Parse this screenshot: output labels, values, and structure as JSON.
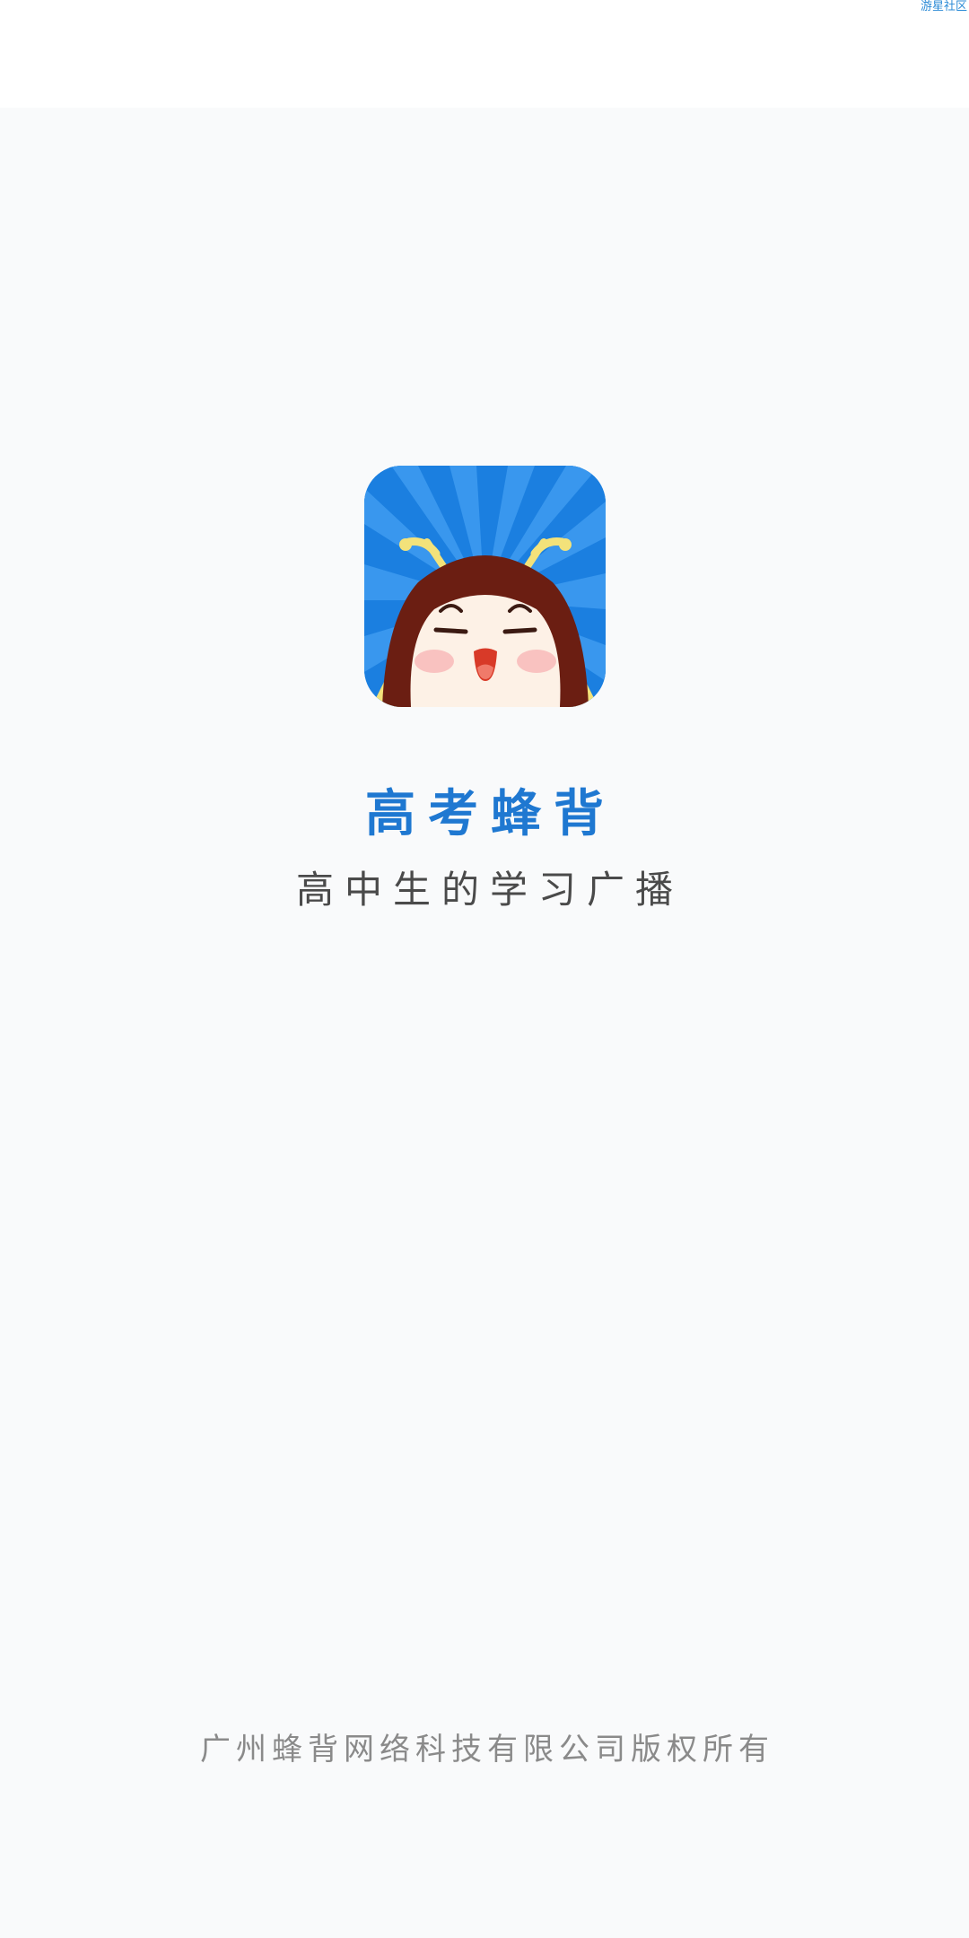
{
  "watermark": "游星社区",
  "splash": {
    "app_icon": "bee-mascot-icon",
    "title": "高考蜂背",
    "subtitle": "高中生的学习广播",
    "copyright": "广州蜂背网络科技有限公司版权所有"
  },
  "colors": {
    "background": "#f9fafb",
    "title": "#1f78d1",
    "subtitle": "#4a4a4a",
    "copyright": "#8a8a8a",
    "icon_blue": "#1b7fe0",
    "mascot_hair": "#6b1e12",
    "mascot_face": "#fdf1e6",
    "antenna": "#f3e27a"
  }
}
